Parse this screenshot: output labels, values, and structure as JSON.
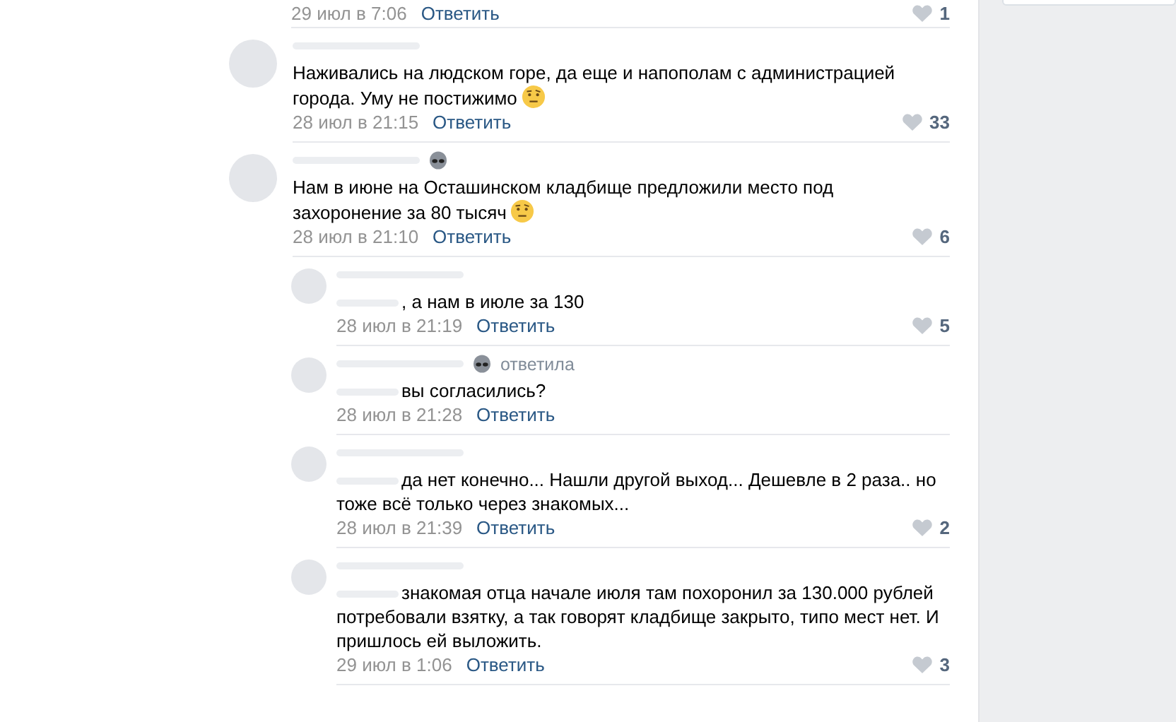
{
  "partial_comment": {
    "date": "29 июл в 7:06",
    "reply": "Ответить",
    "likes": "1"
  },
  "comments": [
    {
      "name_icon": false,
      "mention_hidden": false,
      "text": "Наживались на людском горе, да еще и напополам с администрацией города. Уму не постижимо",
      "ends_with_emoji": true,
      "date": "28 июл в 21:15",
      "reply": "Ответить",
      "likes": "33"
    },
    {
      "name_icon": true,
      "mention_hidden": false,
      "text": "Нам в июне на Осташинском кладбище предложили место под захоронение за 80 тысяч",
      "ends_with_emoji": true,
      "date": "28 июл в 21:10",
      "reply": "Ответить",
      "likes": "6",
      "replies": [
        {
          "name_icon": false,
          "mention_hidden": true,
          "text": ", а нам в июле за 130",
          "ends_with_emoji": false,
          "date": "28 июл в 21:19",
          "reply": "Ответить",
          "likes": "5"
        },
        {
          "name_icon": true,
          "mention_hidden": true,
          "reply_label": "ответила",
          "text": "вы согласились?",
          "ends_with_emoji": false,
          "date": "28 июл в 21:28",
          "reply": "Ответить"
        },
        {
          "name_icon": false,
          "mention_hidden": true,
          "text": "да нет конечно... Нашли другой выход... Дешевле в 2 раза.. но тоже всё только через знакомых...",
          "ends_with_emoji": false,
          "date": "28 июл в 21:39",
          "reply": "Ответить",
          "likes": "2"
        },
        {
          "name_icon": false,
          "mention_hidden": true,
          "text": "знакомая отца начале июля там похоронил за 130.000 рублей потребовали взятку, а так говорят кладбище закрыто, типо мест нет. И пришлось ей выложить.",
          "ends_with_emoji": false,
          "date": "29 июл в 1:06",
          "reply": "Ответить",
          "likes": "3"
        }
      ]
    }
  ]
}
